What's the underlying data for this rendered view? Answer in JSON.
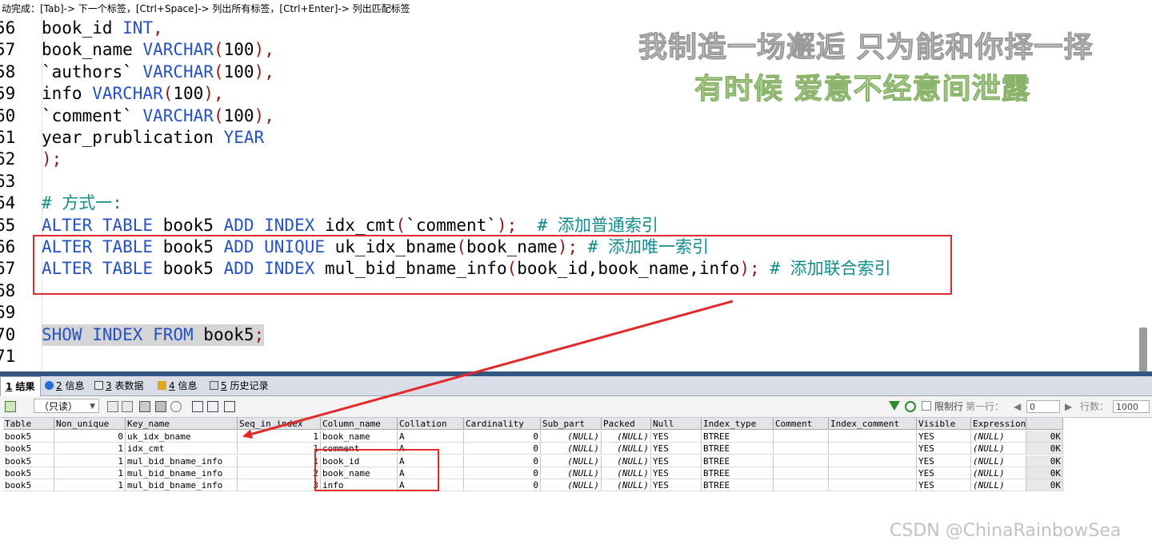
{
  "hint": "动完成：[Tab]-> 下一个标签，[Ctrl+Space]-> 列出所有标签，[Ctrl+Enter]-> 列出匹配标签",
  "watermark": {
    "line1": "我制造一场邂逅 只为能和你择一择",
    "line2": "有时候 爱意不经意间泄露"
  },
  "editor_lines": [
    {
      "n": "56",
      "tokens": [
        {
          "t": "book_id ",
          "c": "tx"
        },
        {
          "t": "INT",
          "c": "kw"
        },
        {
          "t": ",",
          "c": "pn"
        }
      ]
    },
    {
      "n": "57",
      "tokens": [
        {
          "t": "book_name ",
          "c": "tx"
        },
        {
          "t": "VARCHAR",
          "c": "kw"
        },
        {
          "t": "(",
          "c": "pn"
        },
        {
          "t": "100",
          "c": "tx"
        },
        {
          "t": "),",
          "c": "pn"
        }
      ]
    },
    {
      "n": "58",
      "tokens": [
        {
          "t": "`authors` ",
          "c": "tx"
        },
        {
          "t": "VARCHAR",
          "c": "kw"
        },
        {
          "t": "(",
          "c": "pn"
        },
        {
          "t": "100",
          "c": "tx"
        },
        {
          "t": "),",
          "c": "pn"
        }
      ]
    },
    {
      "n": "59",
      "tokens": [
        {
          "t": "info ",
          "c": "tx"
        },
        {
          "t": "VARCHAR",
          "c": "kw"
        },
        {
          "t": "(",
          "c": "pn"
        },
        {
          "t": "100",
          "c": "tx"
        },
        {
          "t": "),",
          "c": "pn"
        }
      ]
    },
    {
      "n": "60",
      "tokens": [
        {
          "t": "`comment` ",
          "c": "tx"
        },
        {
          "t": "VARCHAR",
          "c": "kw"
        },
        {
          "t": "(",
          "c": "pn"
        },
        {
          "t": "100",
          "c": "tx"
        },
        {
          "t": "),",
          "c": "pn"
        }
      ]
    },
    {
      "n": "61",
      "tokens": [
        {
          "t": "year_prublication ",
          "c": "tx"
        },
        {
          "t": "YEAR",
          "c": "kw"
        }
      ]
    },
    {
      "n": "62",
      "tokens": [
        {
          "t": ");",
          "c": "pn"
        }
      ]
    },
    {
      "n": "63",
      "tokens": []
    },
    {
      "n": "64",
      "tokens": [
        {
          "t": "# 方式一:",
          "c": "cm"
        }
      ]
    },
    {
      "n": "65",
      "tokens": [
        {
          "t": "ALTER TABLE ",
          "c": "kw"
        },
        {
          "t": "book5 ",
          "c": "tx"
        },
        {
          "t": "ADD INDEX ",
          "c": "kw"
        },
        {
          "t": "idx_cmt",
          "c": "tx"
        },
        {
          "t": "(",
          "c": "pn"
        },
        {
          "t": "`comment`",
          "c": "tx"
        },
        {
          "t": ");",
          "c": "pn"
        },
        {
          "t": "  # 添加普通索引",
          "c": "cm"
        }
      ]
    },
    {
      "n": "66",
      "tokens": [
        {
          "t": "ALTER TABLE ",
          "c": "kw"
        },
        {
          "t": "book5 ",
          "c": "tx"
        },
        {
          "t": "ADD UNIQUE ",
          "c": "kw"
        },
        {
          "t": "uk_idx_bname",
          "c": "tx"
        },
        {
          "t": "(",
          "c": "pn"
        },
        {
          "t": "book_name",
          "c": "tx"
        },
        {
          "t": ");",
          "c": "pn"
        },
        {
          "t": " # 添加唯一索引",
          "c": "cm"
        }
      ]
    },
    {
      "n": "67",
      "tokens": [
        {
          "t": "ALTER TABLE ",
          "c": "kw"
        },
        {
          "t": "book5 ",
          "c": "tx"
        },
        {
          "t": "ADD INDEX ",
          "c": "kw"
        },
        {
          "t": "mul_bid_bname_info",
          "c": "tx"
        },
        {
          "t": "(",
          "c": "pn"
        },
        {
          "t": "book_id,book_name,info",
          "c": "tx"
        },
        {
          "t": ");",
          "c": "pn"
        },
        {
          "t": " # 添加联合索引",
          "c": "cm"
        }
      ]
    },
    {
      "n": "68",
      "tokens": []
    },
    {
      "n": "69",
      "tokens": []
    },
    {
      "n": "70",
      "highlight": true,
      "tokens": [
        {
          "t": "SHOW INDEX FROM ",
          "c": "kw"
        },
        {
          "t": "book5",
          "c": "tx"
        },
        {
          "t": ";",
          "c": "pn"
        }
      ]
    },
    {
      "n": "71",
      "tokens": []
    }
  ],
  "tabs": [
    {
      "num": "1",
      "label": "结果",
      "icon": "result-icon",
      "active": true
    },
    {
      "num": "2",
      "label": "信息",
      "icon": "info-icon",
      "active": false
    },
    {
      "num": "3",
      "label": "表数据",
      "icon": "table-data-icon",
      "active": false
    },
    {
      "num": "4",
      "label": "信息",
      "icon": "info2-icon",
      "active": false
    },
    {
      "num": "5",
      "label": "历史记录",
      "icon": "history-icon",
      "active": false
    }
  ],
  "toolbar": {
    "readonly": "（只读）",
    "limit_label": "限制行",
    "first_row_label": "第一行：",
    "first_row_value": "0",
    "row_count_label": "行数：",
    "row_count_value": "1000"
  },
  "grid": {
    "columns": [
      "Table",
      "Non_unique",
      "Key_name",
      "Seq_in_index",
      "Column_name",
      "Collation",
      "Cardinality",
      "Sub_part",
      "Packed",
      "Null",
      "Index_type",
      "Comment",
      "Index_comment",
      "Visible",
      "Expression",
      ""
    ],
    "rows": [
      [
        "book5",
        "0",
        "uk_idx_bname",
        "1",
        "book_name",
        "A",
        "0",
        "(NULL)",
        "(NULL)",
        "YES",
        "BTREE",
        "",
        "",
        "YES",
        "(NULL)",
        "0K"
      ],
      [
        "book5",
        "1",
        "idx_cmt",
        "1",
        "comment",
        "A",
        "0",
        "(NULL)",
        "(NULL)",
        "YES",
        "BTREE",
        "",
        "",
        "YES",
        "(NULL)",
        "0K"
      ],
      [
        "book5",
        "1",
        "mul_bid_bname_info",
        "1",
        "book_id",
        "A",
        "0",
        "(NULL)",
        "(NULL)",
        "YES",
        "BTREE",
        "",
        "",
        "YES",
        "(NULL)",
        "0K"
      ],
      [
        "book5",
        "1",
        "mul_bid_bname_info",
        "2",
        "book_name",
        "A",
        "0",
        "(NULL)",
        "(NULL)",
        "YES",
        "BTREE",
        "",
        "",
        "YES",
        "(NULL)",
        "0K"
      ],
      [
        "book5",
        "1",
        "mul_bid_bname_info",
        "3",
        "info",
        "A",
        "0",
        "(NULL)",
        "(NULL)",
        "YES",
        "BTREE",
        "",
        "",
        "YES",
        "(NULL)",
        "0K"
      ]
    ]
  },
  "credit": "CSDN @ChinaRainbowSea",
  "colors": {
    "keyword": "#2452c6",
    "comment": "#108d8d",
    "paren": "#8b1a1a",
    "annotation": "#e22a2a"
  }
}
